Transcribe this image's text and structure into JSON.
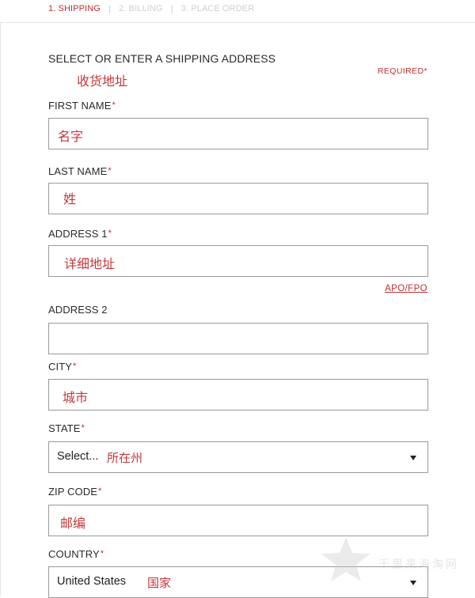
{
  "steps": [
    {
      "label": "1. SHIPPING",
      "active": true
    },
    {
      "label": "2. BILLING",
      "active": false
    },
    {
      "label": "3. PLACE ORDER",
      "active": false
    }
  ],
  "section": {
    "title": "SELECT OR ENTER A SHIPPING ADDRESS",
    "annotation": "收货地址",
    "required_label": "REQUIRED",
    "required_star": "*"
  },
  "fields": {
    "first_name": {
      "label": "FIRST NAME",
      "star": "*",
      "value": "名字"
    },
    "last_name": {
      "label": "LAST NAME",
      "star": "*",
      "value": "姓"
    },
    "address1": {
      "label": "ADDRESS 1",
      "star": "*",
      "value": "详细地址"
    },
    "address2": {
      "label": "ADDRESS 2",
      "star": "",
      "value": ""
    },
    "city": {
      "label": "CITY",
      "star": "*",
      "value": "城市"
    },
    "state": {
      "label": "STATE",
      "star": "*",
      "selected": "Select...",
      "annotation": "所在州"
    },
    "zip": {
      "label": "ZIP CODE",
      "star": "*",
      "value": "邮编"
    },
    "country": {
      "label": "COUNTRY",
      "star": "*",
      "selected": "United States",
      "annotation": "国家"
    }
  },
  "apo_link": "APO/FPO",
  "watermark": {
    "text": "千里来海淘网",
    "icon": "star-logo-icon"
  },
  "colors": {
    "accent": "#b83236",
    "annotation": "#c0393b",
    "border": "#9a9a9a",
    "inactive_step": "#cfcfcf"
  }
}
